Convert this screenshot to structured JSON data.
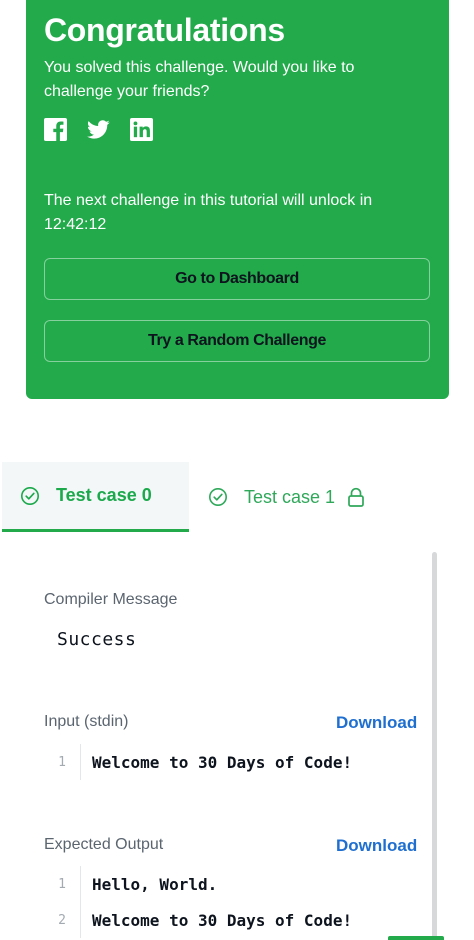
{
  "congrats": {
    "title": "Congratulations",
    "subtitle": "You solved this challenge. Would you like to challenge your friends?",
    "social": [
      "facebook-icon",
      "twitter-icon",
      "linkedin-icon"
    ],
    "unlock_text": "The next challenge in this tutorial will unlock in 12:42:12",
    "dashboard_button": "Go to Dashboard",
    "random_button": "Try a Random Challenge",
    "bg_color": "#22aa4b"
  },
  "tabs": [
    {
      "label": "Test case 0",
      "status": "passed",
      "locked": false,
      "active": true
    },
    {
      "label": "Test case 1",
      "status": "passed",
      "locked": true,
      "active": false
    }
  ],
  "results": {
    "compiler_label": "Compiler Message",
    "compiler_message": "Success",
    "input_label": "Input (stdin)",
    "input_download": "Download",
    "input_lines": [
      {
        "no": "1",
        "text": "Welcome to 30 Days of Code!"
      }
    ],
    "output_label": "Expected Output",
    "output_download": "Download",
    "output_lines": [
      {
        "no": "1",
        "text": "Hello, World."
      },
      {
        "no": "2",
        "text": "Welcome to 30 Days of Code!"
      }
    ],
    "link_color": "#1f6fd0"
  }
}
